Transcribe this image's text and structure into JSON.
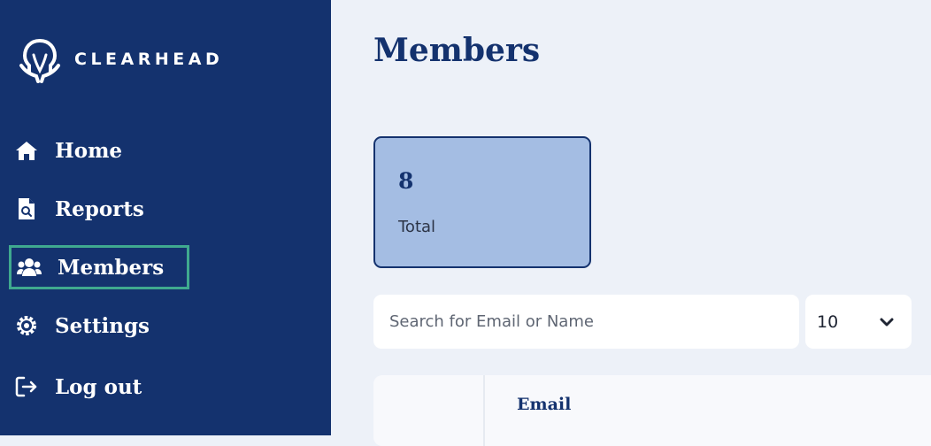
{
  "brand": {
    "name": "CLEARHEAD"
  },
  "sidebar": {
    "items": [
      {
        "label": "Home",
        "icon": "home-icon"
      },
      {
        "label": "Reports",
        "icon": "report-icon"
      },
      {
        "label": "Members",
        "icon": "users-icon",
        "active": true
      },
      {
        "label": "Settings",
        "icon": "gear-icon"
      },
      {
        "label": "Log out",
        "icon": "logout-icon"
      }
    ]
  },
  "main": {
    "title": "Members",
    "stats": {
      "total_value": "8",
      "total_label": "Total"
    },
    "search": {
      "placeholder": "Search for Email or Name",
      "value": ""
    },
    "page_size": {
      "selected": "10",
      "icon": "chevron-down-icon"
    },
    "table": {
      "columns": [
        "Email"
      ]
    }
  },
  "colors": {
    "sidebar_bg": "#14326e",
    "page_bg": "#edf1f8",
    "active_outline": "#3fa98f",
    "card_bg": "#a4bde3",
    "heading": "#14326e"
  }
}
